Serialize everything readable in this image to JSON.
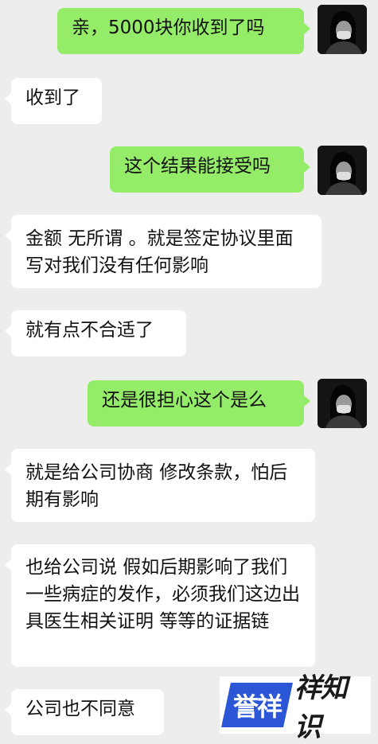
{
  "messages": [
    {
      "side": "right",
      "text": "亲，5000块你收到了吗"
    },
    {
      "side": "left",
      "text": "收到了"
    },
    {
      "side": "right",
      "text": "这个结果能接受吗"
    },
    {
      "side": "left",
      "text": "金额 无所谓 。就是签定协议里面写对我们没有任何影响"
    },
    {
      "side": "left",
      "text": "就有点不合适了"
    },
    {
      "side": "right",
      "text": "还是很担心这个是么"
    },
    {
      "side": "left",
      "text": "就是给公司协商 修改条款，怕后期有影响"
    },
    {
      "side": "left",
      "text": "也给公司说 假如后期影响了我们一些病症的发作，必须我们这边出具医生相关证明 等等的证据链"
    },
    {
      "side": "left",
      "text": "公司也不同意"
    }
  ],
  "watermark": {
    "logo": "誉祥",
    "text": "祥知识"
  },
  "colors": {
    "background": "#ededed",
    "sent_bubble": "#95ec69",
    "received_bubble": "#ffffff",
    "watermark_blue": "#2b56d6"
  },
  "icons": {
    "avatar": "user-avatar-icon"
  }
}
